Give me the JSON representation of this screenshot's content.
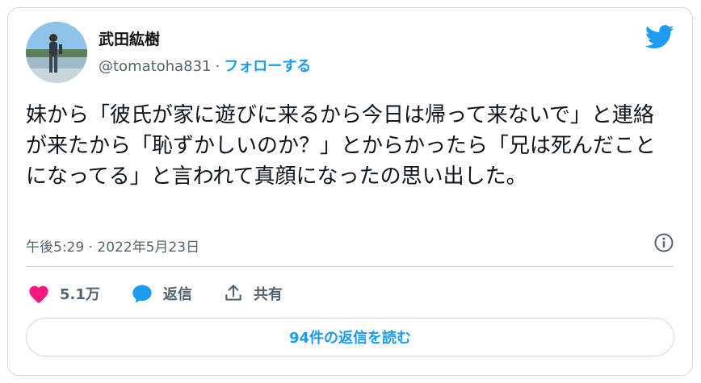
{
  "tweet": {
    "author": {
      "name": "武田紘樹",
      "handle": "@tomatoha831",
      "separator": "·",
      "follow_label": "フォローする"
    },
    "text": "妹から「彼氏が家に遊びに来るから今日は帰って来ないで」と連絡が来たから「恥ずかしいのか？」とからかったら「兄は死んだことになってる」と言われて真顔になったの思い出した。",
    "timestamp": "午後5:29 · 2022年5月23日",
    "actions": {
      "like_count": "5.1万",
      "reply_label": "返信",
      "share_label": "共有"
    },
    "read_replies_label": "94件の返信を読む"
  },
  "colors": {
    "accent": "#1d9bf0",
    "like": "#f91880",
    "muted": "#536471",
    "text": "#0f1419",
    "border": "#cfd9de"
  },
  "icons": {
    "brand": "twitter-bird-icon",
    "info": "info-icon",
    "like": "heart-icon",
    "reply": "speech-bubble-icon",
    "share": "share-icon"
  }
}
